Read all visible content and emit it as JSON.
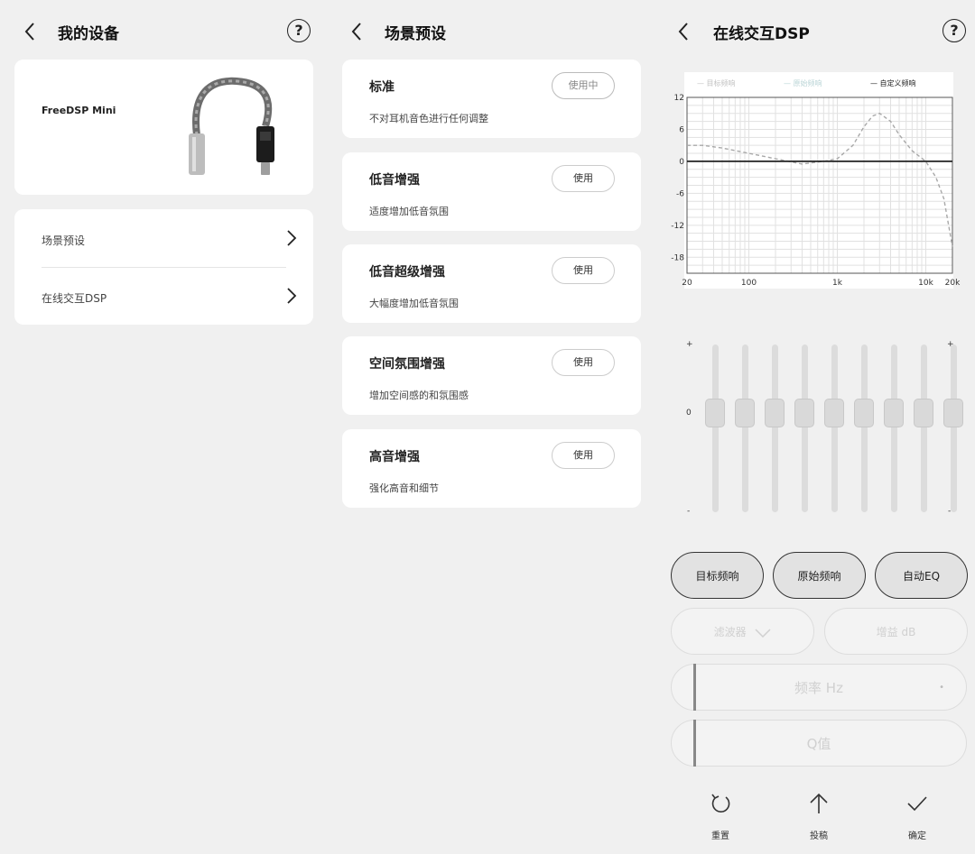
{
  "device_panel": {
    "title": "我的设备",
    "help_label": "?",
    "device_name": "FreeDSP Mini",
    "menu": [
      {
        "label": "场景预设"
      },
      {
        "label": "在线交互DSP"
      }
    ]
  },
  "preset_panel": {
    "title": "场景预设",
    "presets": [
      {
        "name": "标准",
        "desc": "不对耳机音色进行任何调整",
        "button": "使用中",
        "active": true
      },
      {
        "name": "低音增强",
        "desc": "适度增加低音氛围",
        "button": "使用",
        "active": false
      },
      {
        "name": "低音超级增强",
        "desc": "大幅度增加低音氛围",
        "button": "使用",
        "active": false
      },
      {
        "name": "空间氛围增强",
        "desc": "增加空间感的和氛围感",
        "button": "使用",
        "active": false
      },
      {
        "name": "高音增强",
        "desc": "强化高音和细节",
        "button": "使用",
        "active": false
      }
    ]
  },
  "dsp_panel": {
    "title": "在线交互DSP",
    "help_label": "?",
    "chart_data": {
      "type": "line",
      "legend": [
        "目标频响",
        "原始频响",
        "自定义频响"
      ],
      "legend_position": "top",
      "grid": true,
      "x_scale": "log",
      "xlim": [
        20,
        20000
      ],
      "ylim": [
        -21,
        12
      ],
      "x_ticks": [
        "20",
        "100",
        "1k",
        "10k",
        "20k"
      ],
      "y_ticks": [
        "12",
        "6",
        "0",
        "-6",
        "-12",
        "-18"
      ],
      "series": [
        {
          "name": "目标频响",
          "style": "dashed",
          "color": "#a8a8a8",
          "x": [
            20,
            30,
            50,
            100,
            200,
            400,
            700,
            1000,
            1500,
            2000,
            2500,
            3000,
            4000,
            5000,
            7000,
            10000,
            13000,
            16000,
            20000
          ],
          "y": [
            3,
            3,
            2.5,
            1.5,
            0.5,
            -0.5,
            0,
            0.5,
            3,
            6.5,
            8.5,
            9,
            7.5,
            5,
            2,
            0,
            -3,
            -7,
            -16
          ]
        },
        {
          "name": "原始频响",
          "style": "solid",
          "color": "#b9d4d6",
          "x": [],
          "y": []
        },
        {
          "name": "自定义频响",
          "style": "solid",
          "color": "#222222",
          "x": [
            20,
            20000
          ],
          "y": [
            0,
            0
          ]
        }
      ]
    },
    "eq": {
      "plus_label": "+",
      "zero_label": "0",
      "minus_label": "-",
      "bands": [
        0,
        0,
        0,
        0,
        0,
        0,
        0,
        0,
        0
      ]
    },
    "buttons": {
      "target": "目标频响",
      "original": "原始频响",
      "auto_eq": "自动EQ",
      "filter": "滤波器",
      "gain": "增益 dB",
      "freq": "频率  Hz",
      "q": "Q值"
    },
    "actions": {
      "reset": "重置",
      "submit": "投稿",
      "confirm": "确定"
    }
  }
}
